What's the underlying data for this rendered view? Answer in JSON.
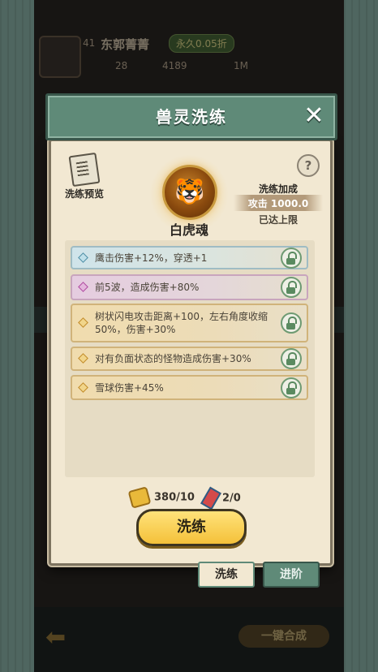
{
  "background": {
    "player": {
      "level": "41",
      "name": "东郭菁菁",
      "vip": "永久0.05折"
    },
    "currencies": [
      "28",
      "4189",
      "1M"
    ],
    "merge_button": "一键合成"
  },
  "modal": {
    "title": "兽灵洗练",
    "preview_label": "洗练预览",
    "help": "?",
    "soul_name": "白虎魂",
    "bonus": {
      "title": "洗练加成",
      "value": "攻击 1000.0",
      "status": "已达上限"
    },
    "attributes": [
      {
        "text": "鹰击伤害+12%，穿透+1",
        "rarity": "blue"
      },
      {
        "text": "前5波，造成伤害+80%",
        "rarity": "purple"
      },
      {
        "text": "树状闪电攻击距离+100，左右角度收缩50%，伤害+30%",
        "rarity": "gold"
      },
      {
        "text": "对有负面状态的怪物造成伤害+30%",
        "rarity": "gold"
      },
      {
        "text": "雪球伤害+45%",
        "rarity": "gold"
      }
    ],
    "costs": {
      "coin": "380/10",
      "scroll": "2/0"
    },
    "wash_button": "洗练",
    "tabs": {
      "active": "洗练",
      "other": "进阶"
    }
  }
}
